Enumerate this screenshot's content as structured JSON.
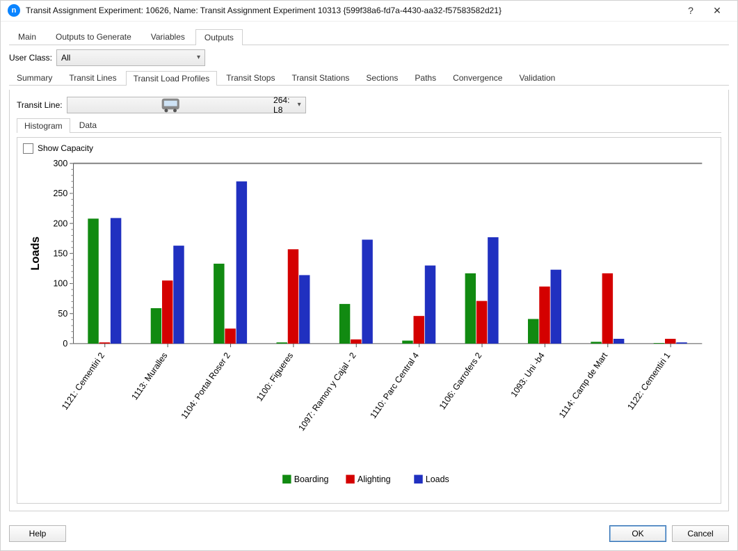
{
  "window": {
    "title": "Transit Assignment Experiment: 10626, Name: Transit Assignment Experiment 10313  {599f38a6-fd7a-4430-aa32-f57583582d21}",
    "help_btn": "?",
    "close_btn": "✕"
  },
  "tabs_main": {
    "items": [
      "Main",
      "Outputs to Generate",
      "Variables",
      "Outputs"
    ],
    "active": 3
  },
  "user_class": {
    "label": "User Class:",
    "value": "All"
  },
  "tabs_outputs": {
    "items": [
      "Summary",
      "Transit Lines",
      "Transit Load Profiles",
      "Transit Stops",
      "Transit Stations",
      "Sections",
      "Paths",
      "Convergence",
      "Validation"
    ],
    "active": 2
  },
  "transit_line": {
    "label": "Transit Line:",
    "value": "264: L8",
    "icon_name": "bus-icon"
  },
  "tabs_view": {
    "items": [
      "Histogram",
      "Data"
    ],
    "active": 0
  },
  "show_capacity": {
    "label": "Show Capacity",
    "checked": false
  },
  "chart_data": {
    "type": "bar",
    "ylabel": "Loads",
    "ylim": [
      0,
      300
    ],
    "yticks": [
      0,
      50,
      100,
      150,
      200,
      250,
      300
    ],
    "categories": [
      "1121: Cementiri 2",
      "1113: Muralles",
      "1104: Portal Roser 2",
      "1100: Figueres",
      "1097: Ramon y Cajal - 2",
      "1110: Parc Central 4",
      "1106: Garrofers 2",
      "1093: Uni -b4",
      "1114: Camp de Mart",
      "1122: Cementiri 1"
    ],
    "series": [
      {
        "name": "Boarding",
        "color": "#118a11",
        "values": [
          208,
          59,
          133,
          2,
          66,
          5,
          117,
          41,
          3,
          1
        ]
      },
      {
        "name": "Alighting",
        "color": "#d40000",
        "values": [
          2,
          105,
          25,
          157,
          7,
          46,
          71,
          95,
          117,
          8
        ]
      },
      {
        "name": "Loads",
        "color": "#2030c0",
        "values": [
          209,
          163,
          270,
          114,
          173,
          130,
          177,
          123,
          8,
          2
        ]
      }
    ]
  },
  "footer": {
    "help": "Help",
    "ok": "OK",
    "cancel": "Cancel"
  }
}
